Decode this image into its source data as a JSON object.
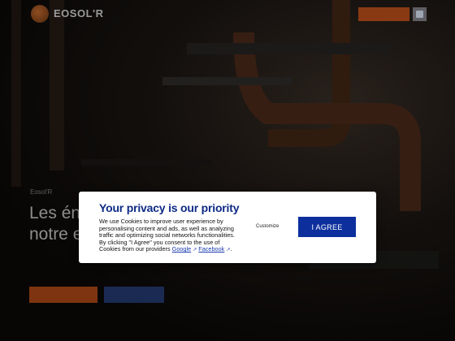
{
  "header": {
    "logo_name": "EOSOL'R",
    "logo_tag": "",
    "cta_label": "",
    "language_flag": "flag-icon"
  },
  "hero": {
    "eyebrow": "Eosol'R",
    "title_line1": "Les éne",
    "title_line2": "notre ex",
    "subtitle": "",
    "primary_button": "",
    "secondary_button": ""
  },
  "cookie_modal": {
    "title": "Your privacy is our priority",
    "body_text": "We use Cookies to improve user experience by personalising content and ads, as well as analyzing traffic and optimizing social networks functionalities. By clicking \"I Agree\" you consent to the use of Cookies from our providers",
    "link_google": "Google",
    "link_facebook": "Facebook",
    "link_separator": ".",
    "customize_label": "Customize",
    "agree_label": "I AGREE"
  },
  "colors": {
    "modal_title": "#0d2a86",
    "agree_button": "#0d2f9e",
    "brand_orange": "#8a3a12"
  }
}
